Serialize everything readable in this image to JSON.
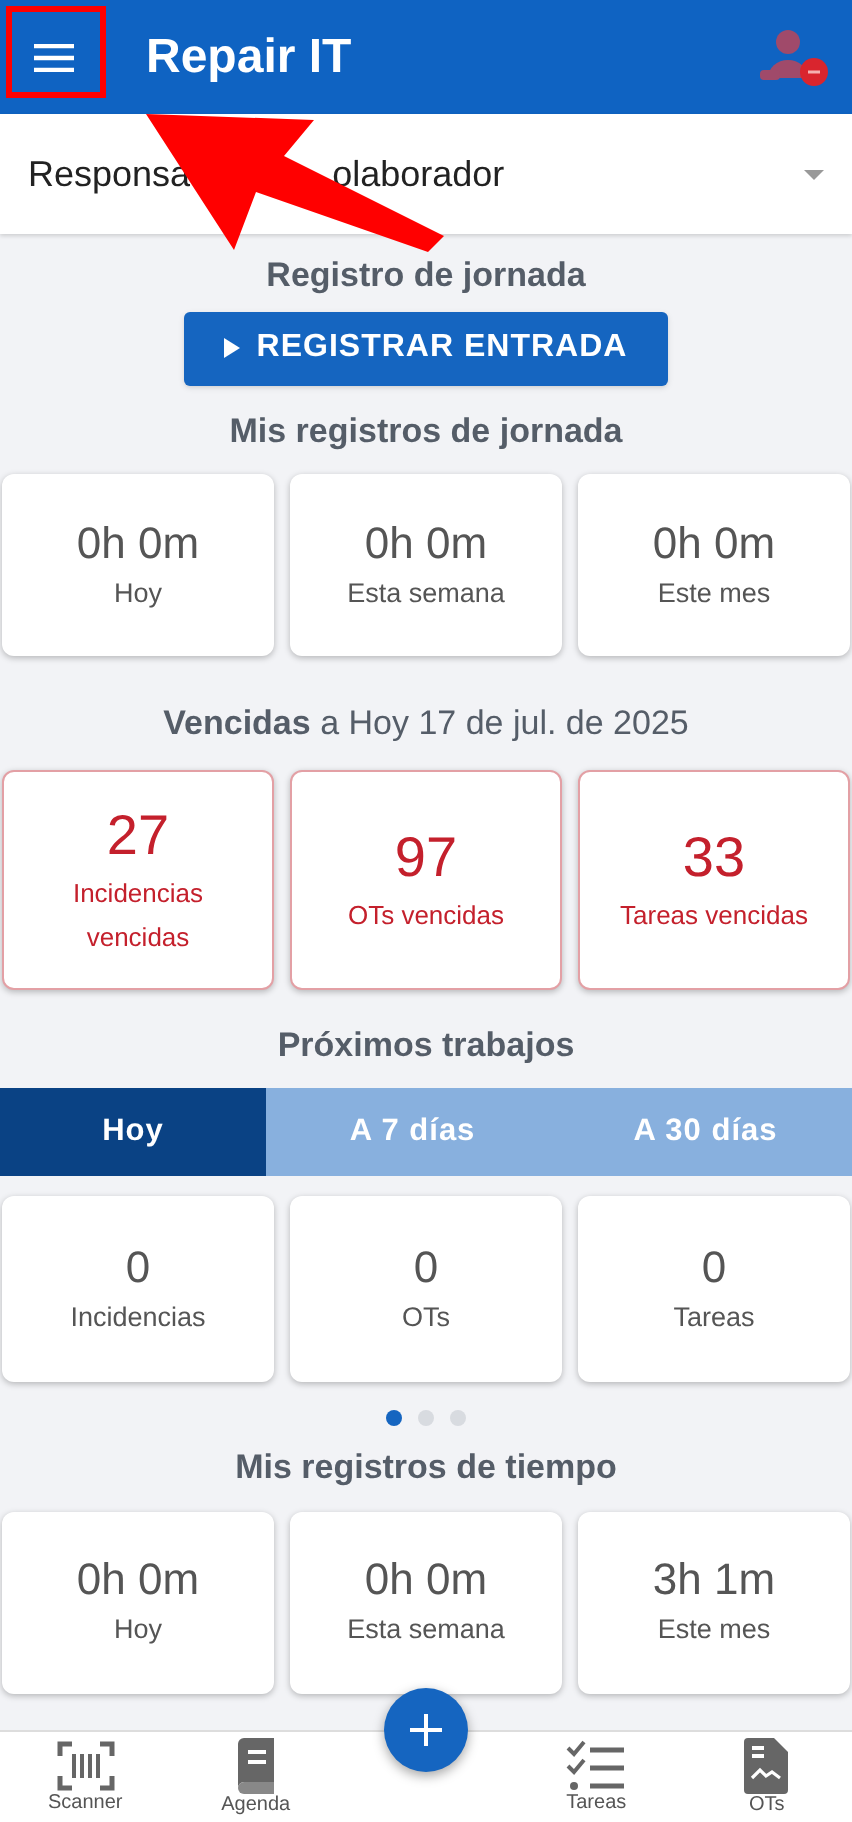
{
  "app_bar": {
    "title": "Repair IT"
  },
  "role_select": {
    "value_parts": [
      "Responsa",
      "olaborador"
    ]
  },
  "attendance": {
    "title": "Registro de jornada",
    "button": "REGISTRAR ENTRADA"
  },
  "my_attendance": {
    "title": "Mis registros de jornada",
    "cards": [
      {
        "value": "0h 0m",
        "label": "Hoy"
      },
      {
        "value": "0h 0m",
        "label": "Esta semana"
      },
      {
        "value": "0h 0m",
        "label": "Este mes"
      }
    ]
  },
  "overdue": {
    "title": "**Vencidas** a Hoy 17 de jul. de 2025",
    "cards": [
      {
        "value": "27",
        "label": "Incidencias vencidas"
      },
      {
        "value": "97",
        "label": "OTs vencidas"
      },
      {
        "value": "33",
        "label": "Tareas vencidas"
      }
    ]
  },
  "upcoming": {
    "title": "Próximos trabajos",
    "tabs": [
      {
        "label": "Hoy",
        "selected": true
      },
      {
        "label": "A 7 días",
        "selected": false
      },
      {
        "label": "A 30 días",
        "selected": false
      }
    ],
    "cards": [
      {
        "value": "0",
        "label": "Incidencias"
      },
      {
        "value": "0",
        "label": "OTs"
      },
      {
        "value": "0",
        "label": "Tareas"
      }
    ],
    "pages": [
      {
        "selected": true
      },
      {
        "selected": false
      },
      {
        "selected": false
      }
    ]
  },
  "my_time": {
    "title": "Mis registros de tiempo",
    "cards": [
      {
        "value": "0h 0m",
        "label": "Hoy"
      },
      {
        "value": "0h 0m",
        "label": "Esta semana"
      },
      {
        "value": "3h 1m",
        "label": "Este mes"
      }
    ]
  },
  "bottom_nav": [
    {
      "kind": "scanner",
      "label": "Scanner"
    },
    {
      "kind": "agenda",
      "label": "Agenda"
    },
    {
      "kind": "tasks",
      "label": "Tareas"
    },
    {
      "kind": "document",
      "label": "OTs"
    }
  ]
}
